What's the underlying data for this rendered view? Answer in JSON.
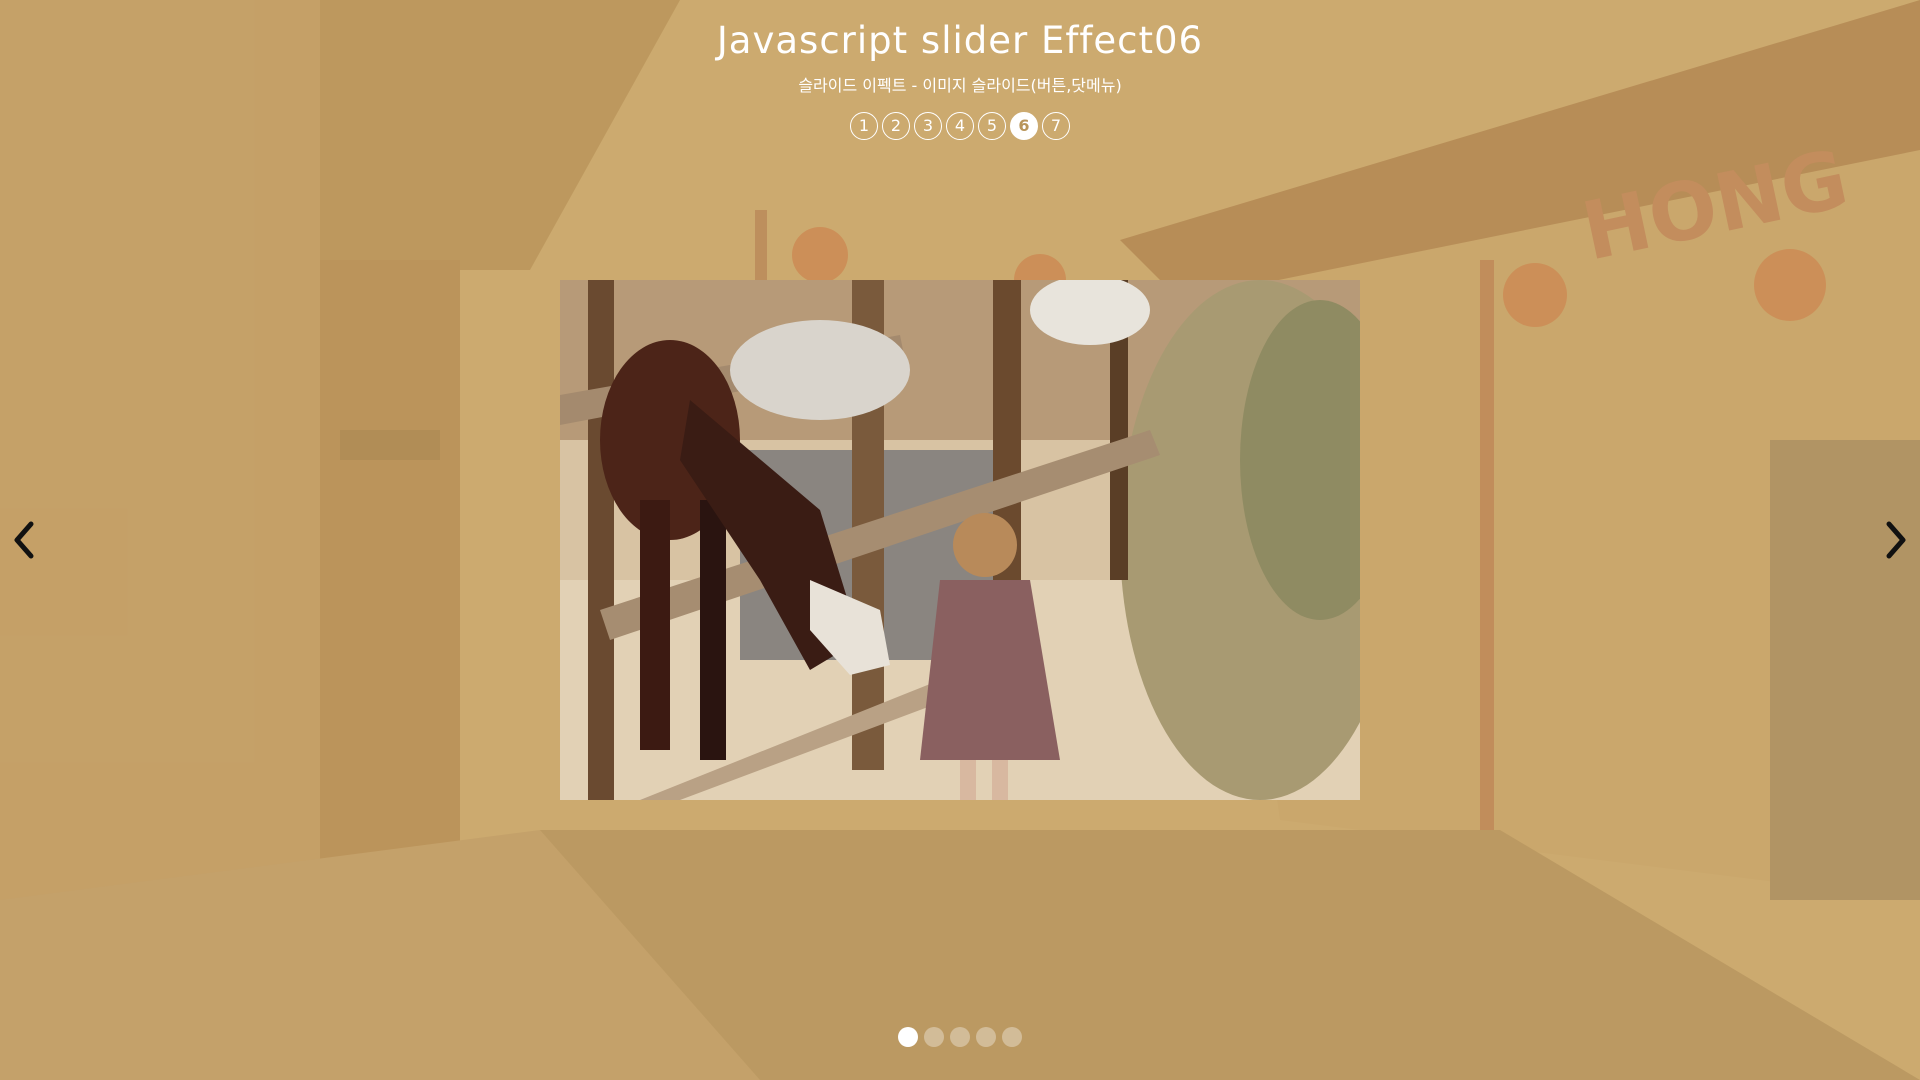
{
  "header": {
    "title": "Javascript slider Effect06",
    "subtitle": "슬라이드 이펙트 - 이미지 슬라이드(버튼,닷메뉴)"
  },
  "effect_nav": {
    "items": [
      "1",
      "2",
      "3",
      "4",
      "5",
      "6",
      "7"
    ],
    "active_index": 5
  },
  "slider": {
    "current_slide": 1,
    "slide_count": 5
  },
  "arrows": {
    "prev_icon": "chevron-left-icon",
    "next_icon": "chevron-right-icon"
  },
  "colors": {
    "accent": "#ffffff",
    "background_tint": "#cdaa6e"
  }
}
